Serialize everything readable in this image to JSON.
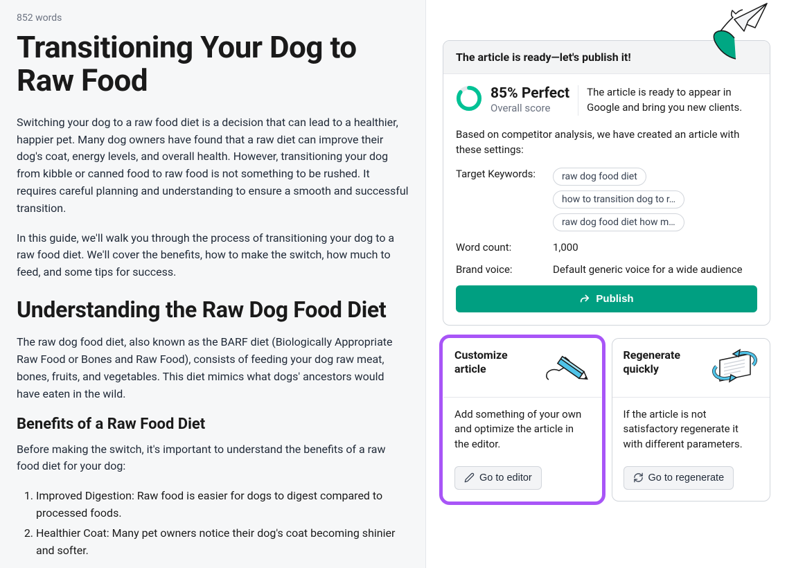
{
  "article": {
    "word_count": "852 words",
    "title": "Transitioning Your Dog to Raw Food",
    "p1": "Switching your dog to a raw food diet is a decision that can lead to a healthier, happier pet. Many dog owners have found that a raw diet can improve their dog's coat, energy levels, and overall health. However, transitioning your dog from kibble or canned food to raw food is not something to be rushed. It requires careful planning and understanding to ensure a smooth and successful transition.",
    "p2": "In this guide, we'll walk you through the process of transitioning your dog to a raw food diet. We'll cover the benefits, how to make the switch, how much to feed, and some tips for success.",
    "h2_1": "Understanding the Raw Dog Food Diet",
    "p3": "The raw dog food diet, also known as the BARF diet (Biologically Appropriate Raw Food or Bones and Raw Food), consists of feeding your dog raw meat, bones, fruits, and vegetables. This diet mimics what dogs' ancestors would have eaten in the wild.",
    "h3_1": "Benefits of a Raw Food Diet",
    "p4": "Before making the switch, it's important to understand the benefits of a raw food diet for your dog:",
    "li1": "Improved Digestion: Raw food is easier for dogs to digest compared to processed foods.",
    "li2": "Healthier Coat: Many pet owners notice their dog's coat becoming shinier and softer."
  },
  "sidebar": {
    "ready_header": "The article is ready—let's publish it!",
    "score_percent": "85% Perfect",
    "score_label": "Overall score",
    "score_desc": "The article is ready to appear in Google and bring you new clients.",
    "analysis_text": "Based on competitor analysis, we have created an article with these settings:",
    "keywords_label": "Target Keywords:",
    "keywords": {
      "k1": "raw dog food diet",
      "k2": "how to transition dog to r…",
      "k3": "raw dog food diet how m…"
    },
    "wordcount_label": "Word count:",
    "wordcount_value": "1,000",
    "brandvoice_label": "Brand voice:",
    "brandvoice_value": "Default generic voice for a wide audience",
    "publish_label": "Publish",
    "customize": {
      "title": "Customize article",
      "desc": "Add something of your own and optimize the article in the editor.",
      "btn": "Go to editor"
    },
    "regenerate": {
      "title": "Regenerate quickly",
      "desc": "If the article is not satisfactory regenerate it with different parameters.",
      "btn": "Go to regenerate"
    }
  }
}
